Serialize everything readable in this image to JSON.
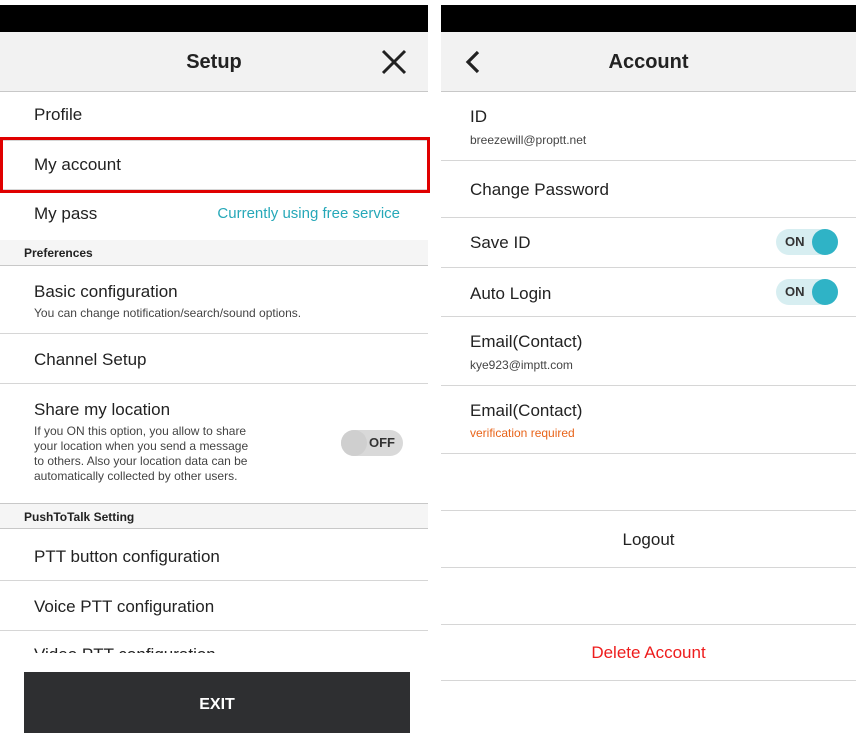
{
  "setup": {
    "title": "Setup",
    "items": {
      "profile": "Profile",
      "my_account": "My account",
      "my_pass": "My pass",
      "my_pass_status": "Currently using free service"
    },
    "preferences_header": "Preferences",
    "basic_config": {
      "title": "Basic configuration",
      "subtitle": "You can change notification/search/sound options."
    },
    "channel_setup": "Channel Setup",
    "share_location": {
      "title": "Share my location",
      "desc_lines": [
        "If you ON this option, you allow to share",
        "your location when you send a message",
        "to others. Also your location data can be",
        "automatically collected by other users."
      ],
      "toggle": "OFF"
    },
    "ptt_header": "PushToTalk Setting",
    "ptt_button_config": "PTT button configuration",
    "voice_ptt_config": "Voice PTT configuration",
    "video_ptt_config": "Video PTT configuration",
    "exit_label": "EXIT"
  },
  "account": {
    "title": "Account",
    "id_label": "ID",
    "id_value": "breezewill@proptt.net",
    "change_password": "Change Password",
    "save_id": {
      "label": "Save ID",
      "toggle": "ON"
    },
    "auto_login": {
      "label": "Auto Login",
      "toggle": "ON"
    },
    "email_contact_1": {
      "label": "Email(Contact)",
      "value": "kye923@imptt.com"
    },
    "email_contact_2": {
      "label": "Email(Contact)",
      "value": "verification required"
    },
    "logout": "Logout",
    "delete_account": "Delete Account"
  },
  "colors": {
    "accent_teal": "#26a8b8",
    "highlight_red": "#e00000",
    "warning_orange": "#e8641a",
    "delete_red": "#ee1c1c",
    "exit_bg": "#2e2f31"
  }
}
